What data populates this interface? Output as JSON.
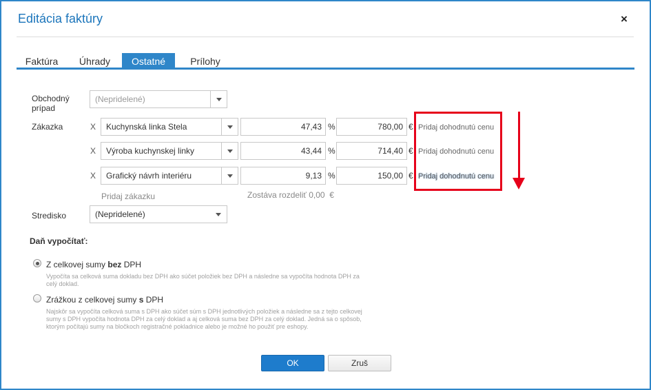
{
  "dialog": {
    "title": "Editácia faktúry",
    "close_label": "×"
  },
  "tabs": [
    {
      "label": "Faktúra",
      "active": false
    },
    {
      "label": "Úhrady",
      "active": false
    },
    {
      "label": "Ostatné",
      "active": true
    },
    {
      "label": "Prílohy",
      "active": false
    }
  ],
  "business_case": {
    "label_line1": "Obchodný",
    "label_line2": "prípad",
    "value": "(Nepridelené)"
  },
  "orders": {
    "label": "Zákazka",
    "remove_label": "X",
    "percent_unit": "%",
    "currency_unit": "€",
    "agreed_price_label": "Pridaj dohodnutú cenu",
    "rows": [
      {
        "name": "Kuchynská linka Stela",
        "percent": "47,43",
        "amount": "780,00"
      },
      {
        "name": "Výroba kuchynskej linky",
        "percent": "43,44",
        "amount": "714,40"
      },
      {
        "name": "Grafický návrh interiéru",
        "percent": "9,13",
        "amount": "150,00"
      }
    ],
    "add_order_label": "Pridaj zákazku",
    "remaining_label": "Zostáva rozdeliť 0,00",
    "remaining_currency": "€"
  },
  "cost_center": {
    "label": "Stredisko",
    "value": "(Nepridelené)"
  },
  "tax": {
    "heading": "Daň vypočítať:",
    "options": [
      {
        "label_pre": "Z celkovej sumy ",
        "label_bold": "bez",
        "label_post": " DPH",
        "checked": true,
        "desc_lines": [
          "Vypočíta sa celková suma dokladu bez DPH ako súčet položiek bez DPH a následne sa vypočíta hodnota DPH za",
          "celý doklad."
        ]
      },
      {
        "label_pre": "Zrážkou z celkovej sumy ",
        "label_bold": "s",
        "label_post": " DPH",
        "checked": false,
        "desc_lines": [
          "Najskôr sa vypočíta celková suma s DPH ako súčet súm s DPH jednotlivých položiek a následne sa z tejto celkovej",
          "sumy s DPH vypočíta hodnota DPH za celý doklad a aj celková suma bez DPH za celý doklad. Jedná sa o spôsob,",
          "ktorým počítajú sumy na bločkoch registračné pokladnice alebo je možné ho použiť pre eshopy."
        ]
      }
    ]
  },
  "buttons": {
    "ok": "OK",
    "cancel": "Zruš"
  },
  "annotation": {
    "highlight_color": "#e6001a"
  }
}
